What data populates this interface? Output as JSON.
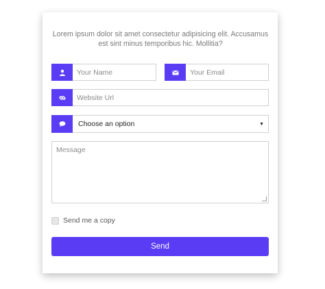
{
  "form": {
    "intro_text": "Lorem ipsum dolor sit amet consectetur adipisicing elit. Accusamus est sint minus temporibus hic. Mollitia?",
    "name_placeholder": "Your Name",
    "email_placeholder": "Your Email",
    "website_placeholder": "Website Url",
    "select_value": "Choose an option",
    "message_placeholder": "Message",
    "copy_label": "Send me a copy",
    "copy_checked": false,
    "send_label": "Send"
  },
  "colors": {
    "accent": "#5b3cf5",
    "border": "#cfcfcf",
    "text_muted": "#7a7a7a"
  },
  "icons": {
    "name": "user-icon",
    "email": "envelope-icon",
    "website": "link-icon",
    "select": "comment-icon"
  }
}
